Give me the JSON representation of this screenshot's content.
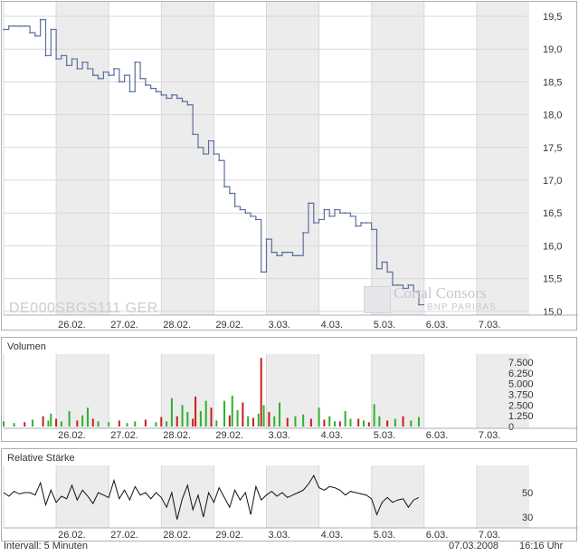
{
  "chart_data": [
    {
      "type": "line",
      "panel": "price",
      "title": "",
      "instrument_label": "DE000SBGS111  GER",
      "brand": {
        "name": "Cortal Consors",
        "sub": "BNP PARIBAS"
      },
      "x_labels": [
        "26.02.",
        "27.02.",
        "28.02.",
        "29.02.",
        "3.03.",
        "4.03.",
        "5.03.",
        "6.03.",
        "7.03."
      ],
      "y_ticks": [
        "19,5",
        "19,0",
        "18,5",
        "18,0",
        "17,5",
        "17,0",
        "16,5",
        "16,0",
        "15,5",
        "15,0"
      ],
      "ylim": [
        14.9,
        19.6
      ],
      "grid": true,
      "series": [
        {
          "color": "#5d6f9e",
          "x": [
            0,
            0.1,
            0.2,
            0.3,
            0.4,
            0.5,
            0.6,
            0.7,
            0.8,
            0.9,
            1.0,
            1.1,
            1.2,
            1.3,
            1.4,
            1.5,
            1.6,
            1.7,
            1.8,
            1.9,
            2.0,
            2.1,
            2.2,
            2.3,
            2.4,
            2.5,
            2.6,
            2.7,
            2.8,
            2.9,
            3.0,
            3.1,
            3.2,
            3.3,
            3.4,
            3.5,
            3.6,
            3.7,
            3.8,
            3.9,
            4.0,
            4.1,
            4.2,
            4.3,
            4.4,
            4.5,
            4.6,
            4.7,
            4.8,
            4.9,
            5.0,
            5.1,
            5.2,
            5.3,
            5.4,
            5.5,
            5.6,
            5.7,
            5.8,
            5.9,
            6.0,
            6.1,
            6.2,
            6.3,
            6.4,
            6.5,
            6.6,
            6.7,
            6.8,
            6.9,
            7.0,
            7.1,
            7.2,
            7.3,
            7.4,
            7.5,
            7.6,
            7.7,
            7.8,
            7.9
          ],
          "y": [
            19.3,
            19.35,
            19.35,
            19.35,
            19.35,
            19.25,
            19.2,
            19.45,
            18.9,
            19.3,
            18.85,
            18.9,
            18.75,
            18.85,
            18.7,
            18.8,
            18.7,
            18.6,
            18.55,
            18.65,
            18.6,
            18.7,
            18.5,
            18.6,
            18.35,
            18.8,
            18.55,
            18.45,
            18.4,
            18.35,
            18.3,
            18.25,
            18.3,
            18.25,
            18.2,
            18.15,
            17.7,
            17.5,
            17.4,
            17.6,
            17.4,
            17.3,
            16.9,
            16.8,
            16.6,
            16.55,
            16.5,
            16.45,
            16.4,
            15.6,
            16.1,
            15.9,
            15.85,
            15.9,
            15.9,
            15.85,
            15.85,
            16.2,
            16.65,
            16.35,
            16.4,
            16.55,
            16.45,
            16.55,
            16.5,
            16.5,
            16.45,
            16.3,
            16.35,
            16.35,
            16.25,
            15.65,
            15.75,
            15.6,
            15.4,
            15.4,
            15.35,
            15.4,
            15.3,
            15.1
          ]
        }
      ]
    },
    {
      "type": "bar",
      "panel": "volume",
      "title": "Volumen",
      "y_ticks": [
        "7.500",
        "6.250",
        "5.000",
        "3.750",
        "2.500",
        "1.250",
        "0"
      ],
      "ylim": [
        0,
        8000
      ],
      "x_labels": [
        "26.02.",
        "27.02.",
        "28.02.",
        "29.02.",
        "3.03.",
        "4.03.",
        "5.03.",
        "6.03.",
        "7.03."
      ],
      "up_color": "#2db22d",
      "down_color": "#c81e1e",
      "series": [
        {
          "name": "",
          "x": [
            0,
            0.2,
            0.4,
            0.55,
            0.75,
            0.85,
            0.9,
            1.0,
            1.1,
            1.25,
            1.4,
            1.5,
            1.6,
            1.7,
            1.8,
            2.0,
            2.2,
            2.35,
            2.5,
            2.7,
            2.9,
            3.0,
            3.1,
            3.2,
            3.3,
            3.4,
            3.5,
            3.6,
            3.65,
            3.75,
            3.85,
            3.95,
            4.05,
            4.2,
            4.3,
            4.35,
            4.45,
            4.55,
            4.65,
            4.75,
            4.85,
            4.9,
            4.95,
            5.05,
            5.15,
            5.25,
            5.4,
            5.55,
            5.7,
            5.85,
            6.0,
            6.1,
            6.2,
            6.3,
            6.4,
            6.5,
            6.6,
            6.75,
            6.85,
            6.95,
            7.05,
            7.15,
            7.3,
            7.45,
            7.6,
            7.75,
            7.9
          ],
          "values": [
            600,
            400,
            500,
            800,
            1200,
            700,
            1500,
            900,
            600,
            1800,
            700,
            1300,
            2200,
            900,
            600,
            500,
            700,
            400,
            600,
            800,
            500,
            1100,
            600,
            3300,
            1200,
            2500,
            1700,
            900,
            3500,
            1800,
            3000,
            2200,
            700,
            3000,
            1300,
            3600,
            1900,
            2800,
            1200,
            1000,
            1500,
            8500,
            2500,
            1700,
            1200,
            2800,
            1000,
            1200,
            1400,
            900,
            2200,
            800,
            1200,
            600,
            600,
            1800,
            900,
            900,
            700,
            500,
            2600,
            1200,
            700,
            900,
            1200,
            700,
            1100
          ],
          "direction": [
            "u",
            "u",
            "d",
            "u",
            "d",
            "u",
            "u",
            "d",
            "u",
            "u",
            "d",
            "u",
            "u",
            "d",
            "u",
            "u",
            "d",
            "u",
            "u",
            "d",
            "u",
            "d",
            "u",
            "u",
            "d",
            "u",
            "u",
            "d",
            "d",
            "u",
            "u",
            "d",
            "u",
            "u",
            "d",
            "u",
            "u",
            "d",
            "u",
            "d",
            "u",
            "d",
            "u",
            "d",
            "u",
            "u",
            "d",
            "u",
            "u",
            "d",
            "u",
            "d",
            "u",
            "u",
            "d",
            "u",
            "u",
            "d",
            "u",
            "d",
            "u",
            "u",
            "d",
            "u",
            "d",
            "u",
            "u"
          ]
        }
      ]
    },
    {
      "type": "line",
      "panel": "relative_strength",
      "title": "Relative Stärke",
      "y_ticks": [
        "50",
        "30"
      ],
      "ylim": [
        20,
        75
      ],
      "x_labels": [
        "26.02.",
        "27.02.",
        "28.02.",
        "29.02.",
        "3.03.",
        "4.03.",
        "5.03.",
        "6.03.",
        "7.03."
      ],
      "series": [
        {
          "name": "",
          "color": "#111111",
          "x": [
            0,
            0.1,
            0.2,
            0.3,
            0.4,
            0.5,
            0.6,
            0.7,
            0.8,
            0.9,
            1.0,
            1.1,
            1.2,
            1.3,
            1.4,
            1.5,
            1.6,
            1.7,
            1.8,
            1.9,
            2.0,
            2.1,
            2.2,
            2.3,
            2.4,
            2.5,
            2.6,
            2.7,
            2.8,
            2.9,
            3.0,
            3.1,
            3.2,
            3.3,
            3.4,
            3.5,
            3.6,
            3.7,
            3.8,
            3.9,
            4.0,
            4.1,
            4.2,
            4.3,
            4.4,
            4.5,
            4.6,
            4.7,
            4.8,
            4.9,
            5.0,
            5.1,
            5.2,
            5.3,
            5.4,
            5.5,
            5.6,
            5.7,
            5.8,
            5.9,
            6.0,
            6.1,
            6.2,
            6.3,
            6.4,
            6.5,
            6.6,
            6.7,
            6.8,
            6.9,
            7.0,
            7.1,
            7.2,
            7.3,
            7.4,
            7.5,
            7.6,
            7.7,
            7.8,
            7.9
          ],
          "values": [
            50,
            47,
            51,
            49,
            50,
            50,
            48,
            58,
            40,
            52,
            42,
            47,
            45,
            56,
            44,
            52,
            47,
            41,
            50,
            48,
            46,
            60,
            45,
            52,
            44,
            55,
            48,
            50,
            45,
            50,
            46,
            38,
            50,
            28,
            45,
            56,
            36,
            48,
            30,
            50,
            42,
            54,
            46,
            38,
            52,
            44,
            50,
            32,
            55,
            44,
            48,
            51,
            47,
            50,
            46,
            48,
            50,
            52,
            57,
            64,
            54,
            52,
            55,
            54,
            52,
            48,
            51,
            50,
            49,
            48,
            45,
            32,
            42,
            46,
            42,
            44,
            45,
            38,
            44,
            46
          ]
        }
      ]
    }
  ],
  "footer": {
    "interval": "Intervall: 5 Minuten",
    "date": "07.03.2008",
    "time": "16:16 Uhr"
  }
}
